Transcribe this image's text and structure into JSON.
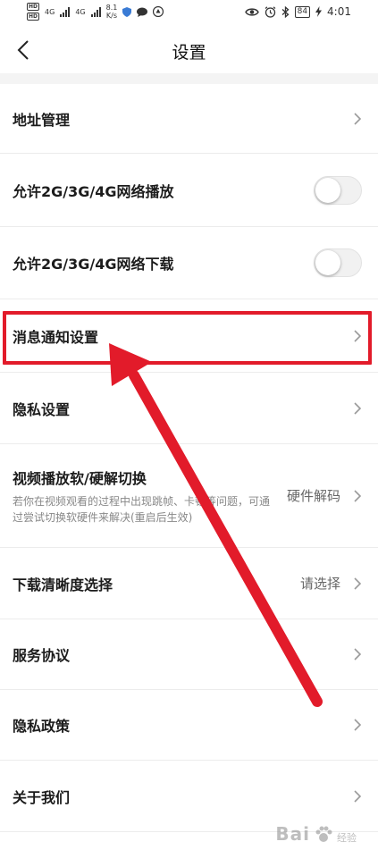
{
  "status_bar": {
    "hd_1": "HD",
    "hd_2": "HD",
    "net_1": "4G",
    "net_2": "4G",
    "speed": "8.1",
    "speed_unit": "K/s",
    "battery": "84",
    "time": "4:01"
  },
  "nav": {
    "title": "设置"
  },
  "rows": [
    {
      "label": "地址管理"
    },
    {
      "label": "允许2G/3G/4G网络播放"
    },
    {
      "label": "允许2G/3G/4G网络下载"
    },
    {
      "label": "消息通知设置"
    },
    {
      "label": "隐私设置"
    },
    {
      "label": "视频播放软/硬解切换",
      "description": "若你在视频观看的过程中出现跳帧、卡顿等问题，可通过尝试切换软硬件来解决(重启后生效)",
      "value": "硬件解码"
    },
    {
      "label": "下载清晰度选择",
      "value": "请选择"
    },
    {
      "label": "服务协议"
    },
    {
      "label": "隐私政策"
    },
    {
      "label": "关于我们"
    }
  ],
  "toggles": {
    "network_play_on": false,
    "network_download_on": false
  },
  "watermark": {
    "logo": "Bai",
    "sub": "经验"
  },
  "colors": {
    "highlight": "#e21b2a",
    "toggle_off": "#f1f1f1"
  }
}
